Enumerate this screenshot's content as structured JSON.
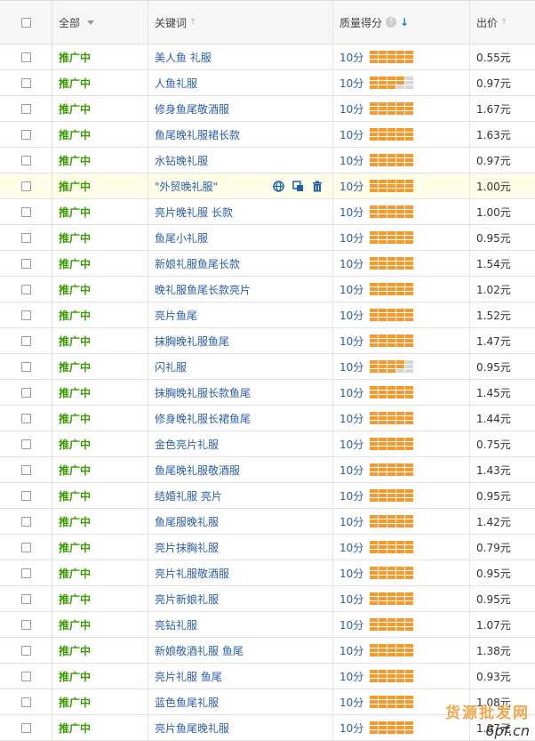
{
  "header": {
    "select_all_label": "全部",
    "keyword_label": "关键词",
    "quality_label": "质量得分",
    "quality_help": "?",
    "price_label": "出价"
  },
  "icons": {
    "up_arrow": "↑",
    "down_arrow": "↓"
  },
  "colors": {
    "status_green": "#3a9b00",
    "link_blue": "#2b5ea8",
    "bar_orange": "#f39a2a",
    "highlight_row": "#fdfde8"
  },
  "rows": [
    {
      "status": "推广中",
      "keyword": "美人鱼 礼服",
      "score": "10分",
      "bars_filled": 15,
      "price": "0.55元"
    },
    {
      "status": "推广中",
      "keyword": "人鱼礼服",
      "score": "10分",
      "bars_filled": 11,
      "price": "0.97元"
    },
    {
      "status": "推广中",
      "keyword": "修身鱼尾敬酒服",
      "score": "10分",
      "bars_filled": 15,
      "price": "1.67元"
    },
    {
      "status": "推广中",
      "keyword": "鱼尾晚礼服裙长款",
      "score": "10分",
      "bars_filled": 15,
      "price": "1.63元"
    },
    {
      "status": "推广中",
      "keyword": "水钻晚礼服",
      "score": "10分",
      "bars_filled": 15,
      "price": "0.97元"
    },
    {
      "status": "推广中",
      "keyword": "\"外贸晚礼服\"",
      "score": "10分",
      "bars_filled": 15,
      "price": "1.00元",
      "highlight": true
    },
    {
      "status": "推广中",
      "keyword": "亮片晚礼服 长款",
      "score": "10分",
      "bars_filled": 15,
      "price": "1.00元"
    },
    {
      "status": "推广中",
      "keyword": "鱼尾小礼服",
      "score": "10分",
      "bars_filled": 15,
      "price": "0.95元"
    },
    {
      "status": "推广中",
      "keyword": "新娘礼服鱼尾长款",
      "score": "10分",
      "bars_filled": 15,
      "price": "1.54元"
    },
    {
      "status": "推广中",
      "keyword": "晚礼服鱼尾长款亮片",
      "score": "10分",
      "bars_filled": 15,
      "price": "1.02元"
    },
    {
      "status": "推广中",
      "keyword": "亮片鱼尾",
      "score": "10分",
      "bars_filled": 15,
      "price": "1.52元"
    },
    {
      "status": "推广中",
      "keyword": "抹胸晚礼服鱼尾",
      "score": "10分",
      "bars_filled": 15,
      "price": "1.47元"
    },
    {
      "status": "推广中",
      "keyword": "闪礼服",
      "score": "10分",
      "bars_filled": 11,
      "price": "0.95元"
    },
    {
      "status": "推广中",
      "keyword": "抹胸晚礼服长款鱼尾",
      "score": "10分",
      "bars_filled": 15,
      "price": "1.45元"
    },
    {
      "status": "推广中",
      "keyword": "修身晚礼服长裙鱼尾",
      "score": "10分",
      "bars_filled": 15,
      "price": "1.44元"
    },
    {
      "status": "推广中",
      "keyword": "金色亮片礼服",
      "score": "10分",
      "bars_filled": 15,
      "price": "0.75元"
    },
    {
      "status": "推广中",
      "keyword": "鱼尾晚礼服敬酒服",
      "score": "10分",
      "bars_filled": 15,
      "price": "1.43元"
    },
    {
      "status": "推广中",
      "keyword": "结婚礼服 亮片",
      "score": "10分",
      "bars_filled": 15,
      "price": "0.95元"
    },
    {
      "status": "推广中",
      "keyword": "鱼尾服晚礼服",
      "score": "10分",
      "bars_filled": 15,
      "price": "1.42元"
    },
    {
      "status": "推广中",
      "keyword": "亮片抹胸礼服",
      "score": "10分",
      "bars_filled": 15,
      "price": "0.79元"
    },
    {
      "status": "推广中",
      "keyword": "亮片礼服敬酒服",
      "score": "10分",
      "bars_filled": 15,
      "price": "0.95元"
    },
    {
      "status": "推广中",
      "keyword": "亮片新娘礼服",
      "score": "10分",
      "bars_filled": 15,
      "price": "0.95元"
    },
    {
      "status": "推广中",
      "keyword": "亮钻礼服",
      "score": "10分",
      "bars_filled": 15,
      "price": "1.07元"
    },
    {
      "status": "推广中",
      "keyword": "新娘敬酒礼服 鱼尾",
      "score": "10分",
      "bars_filled": 15,
      "price": "1.38元"
    },
    {
      "status": "推广中",
      "keyword": "亮片礼服 鱼尾",
      "score": "10分",
      "bars_filled": 15,
      "price": "0.93元"
    },
    {
      "status": "推广中",
      "keyword": "蓝色鱼尾礼服",
      "score": "10分",
      "bars_filled": 15,
      "price": "1.08元"
    },
    {
      "status": "推广中",
      "keyword": "亮片鱼尾晚礼服",
      "score": "10分",
      "bars_filled": 15,
      "price": "1.07元"
    }
  ],
  "watermark": {
    "line1": "货源批发网",
    "line2": "6pf.cn"
  }
}
